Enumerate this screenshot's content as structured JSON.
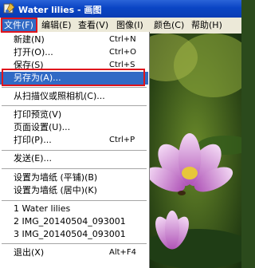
{
  "window": {
    "title": "Water lilies - 画图"
  },
  "menubar": [
    {
      "label": "文件(F)",
      "active": true
    },
    {
      "label": "编辑(E)"
    },
    {
      "label": "查看(V)"
    },
    {
      "label": "图像(I)"
    },
    {
      "label": "颜色(C)"
    },
    {
      "label": "帮助(H)"
    }
  ],
  "file_menu": {
    "new": {
      "label": "新建(N)",
      "shortcut": "Ctrl+N"
    },
    "open": {
      "label": "打开(O)...",
      "shortcut": "Ctrl+O"
    },
    "save": {
      "label": "保存(S)",
      "shortcut": "Ctrl+S"
    },
    "save_as": {
      "label": "另存为(A)..."
    },
    "from_scanner": {
      "label": "从扫描仪或照相机(C)..."
    },
    "print_preview": {
      "label": "打印预览(V)"
    },
    "page_setup": {
      "label": "页面设置(U)..."
    },
    "print": {
      "label": "打印(P)...",
      "shortcut": "Ctrl+P"
    },
    "send": {
      "label": "发送(E)..."
    },
    "wallpaper_tiled": {
      "label": "设置为墙纸 (平铺)(B)"
    },
    "wallpaper_centered": {
      "label": "设置为墙纸 (居中)(K)"
    },
    "recent_1": {
      "label": "1 Water lilies"
    },
    "recent_2": {
      "label": "2 IMG_20140504_093001"
    },
    "recent_3": {
      "label": "3 IMG_20140504_093001"
    },
    "exit": {
      "label": "退出(X)",
      "shortcut": "Alt+F4"
    }
  },
  "colors": {
    "selection": "#316ac5",
    "highlight_box": "#e0141c",
    "title_bar": "#0a45c4"
  }
}
